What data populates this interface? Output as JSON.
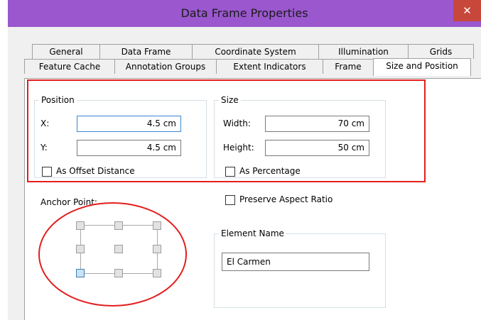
{
  "window": {
    "title": "Data Frame Properties",
    "close_glyph": "✕"
  },
  "tabs_row1": [
    "General",
    "Data Frame",
    "Coordinate System",
    "Illumination",
    "Grids"
  ],
  "tabs_row2": [
    "Feature Cache",
    "Annotation Groups",
    "Extent Indicators",
    "Frame",
    "Size and Position"
  ],
  "active_tab": "Size and Position",
  "position": {
    "title": "Position",
    "x_label": "X:",
    "x_value": "4.5 cm",
    "y_label": "Y:",
    "y_value": "4.5 cm",
    "offset_label": "As Offset Distance",
    "offset_checked": false
  },
  "size": {
    "title": "Size",
    "width_label": "Width:",
    "width_value": "70 cm",
    "height_label": "Height:",
    "height_value": "50 cm",
    "percentage_label": "As Percentage",
    "percentage_checked": false
  },
  "anchor": {
    "label": "Anchor Point:",
    "selected": "bottom-left"
  },
  "preserve_aspect": {
    "label": "Preserve Aspect Ratio",
    "checked": false
  },
  "element_name": {
    "title": "Element Name",
    "value": "El Carmen"
  },
  "colors": {
    "title_bar": "#9a57ce",
    "close_button": "#c7473a",
    "highlight": "#e31e1e",
    "selected_anchor": "#c9e2f7"
  }
}
